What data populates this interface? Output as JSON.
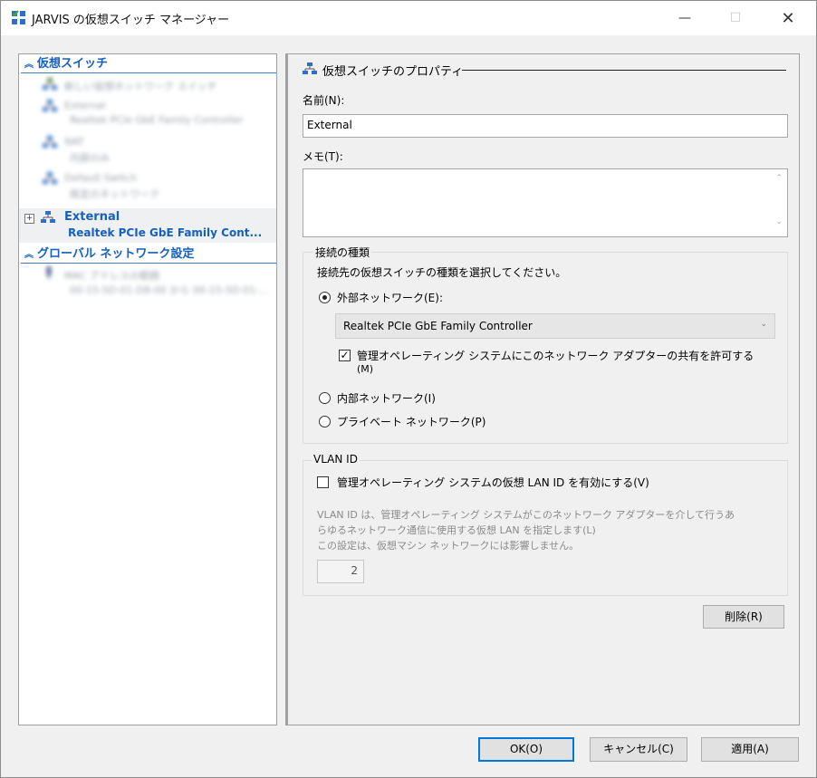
{
  "window": {
    "title": "JARVIS の仮想スイッチ マネージャー",
    "minimize_glyph": "—",
    "maximize_glyph": "☐",
    "close_glyph": "✕"
  },
  "left_pane": {
    "virtual_switches_header": "仮想スイッチ",
    "blurred_items": [
      {
        "name": "新しい仮想ネットワーク スイッチ"
      },
      {
        "name": "External",
        "sub": "Realtek PCIe GbE Family Controller"
      },
      {
        "name": "NAT",
        "sub": "内部のみ"
      },
      {
        "name": "Default Switch",
        "sub": "既定のネットワーク"
      }
    ],
    "selected_item": {
      "expander": "⊞",
      "name": "External",
      "sub": "Realtek PCIe GbE Family Cont..."
    },
    "global_settings_header": "グローバル ネットワーク設定",
    "global_item": {
      "name": "MAC アドレスの範囲",
      "sub": "00-15-5D-01-D8-00 から 00-15-5D-01-..."
    }
  },
  "right_pane": {
    "heading": "仮想スイッチのプロパティ",
    "name_label": "名前(N):",
    "name_value": "External",
    "notes_label": "メモ(T):",
    "notes_value": "",
    "connection_type": {
      "title": "接続の種類",
      "description": "接続先の仮想スイッチの種類を選択してください。",
      "external_label": "外部ネットワーク(E):",
      "external_adapter": "Realtek PCIe GbE Family Controller",
      "allow_share_line1": "管理オペレーティング システムにこのネットワーク アダプターの共有を許可する",
      "allow_share_line2": "(M)",
      "allow_share_checked": true,
      "internal_label": "内部ネットワーク(I)",
      "private_label": "プライベート ネットワーク(P)",
      "selected": "external"
    },
    "vlan": {
      "title": "VLAN ID",
      "enable_label": "管理オペレーティング システムの仮想 LAN ID を有効にする(V)",
      "enable_checked": false,
      "description_line1": "VLAN ID は、管理オペレーティング システムがこのネットワーク アダプターを介して行うあ",
      "description_line2": "らゆるネットワーク通信に使用する仮想 LAN を指定します(L)",
      "description_line3": "この設定は、仮想マシン ネットワークには影響しません。",
      "id_value": "2"
    },
    "remove_button": "削除(R)"
  },
  "buttons": {
    "ok": "OK(O)",
    "cancel": "キャンセル(C)",
    "apply": "適用(A)"
  },
  "colors": {
    "accent_blue": "#1560c0",
    "selection_bg": "#eef0f2",
    "default_button_border": "#0078d7"
  }
}
